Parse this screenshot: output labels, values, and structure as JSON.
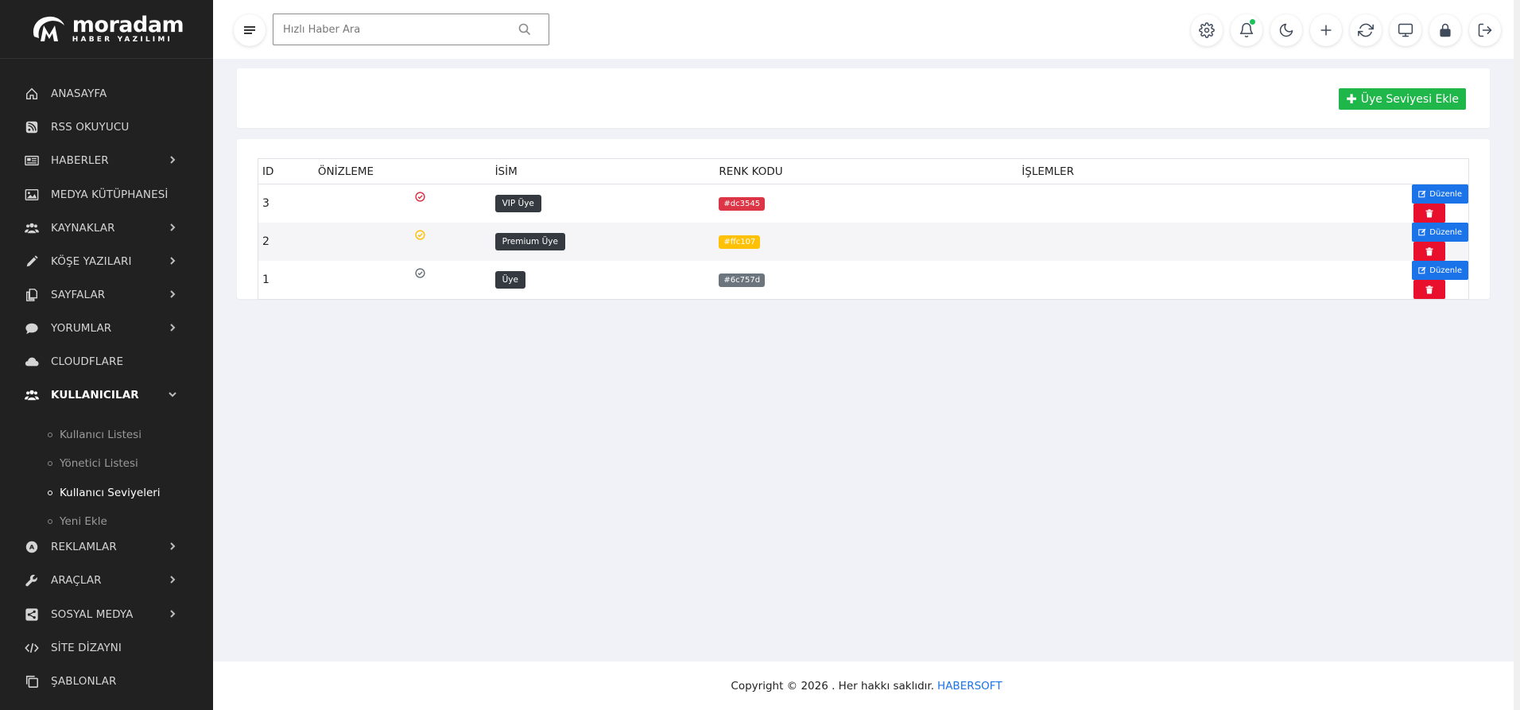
{
  "brand": {
    "name": "moradam",
    "tagline": "HABER YAZILIMI"
  },
  "sidebar": {
    "items": [
      {
        "label": "ANASAYFA",
        "icon": "home-icon",
        "chevron": false
      },
      {
        "label": "RSS OKUYUCU",
        "icon": "rss-icon",
        "chevron": false
      },
      {
        "label": "HABERLER",
        "icon": "newspaper-icon",
        "chevron": true
      },
      {
        "label": "MEDYA KÜTÜPHANESİ",
        "icon": "image-icon",
        "chevron": false
      },
      {
        "label": "KAYNAKLAR",
        "icon": "users-icon",
        "chevron": true
      },
      {
        "label": "KÖŞE YAZILARI",
        "icon": "pencil-icon",
        "chevron": true
      },
      {
        "label": "SAYFALAR",
        "icon": "pages-icon",
        "chevron": true
      },
      {
        "label": "YORUMLAR",
        "icon": "comment-icon",
        "chevron": true
      },
      {
        "label": "CLOUDFLARE",
        "icon": "cloud-icon",
        "chevron": false
      },
      {
        "label": "KULLANICILAR",
        "icon": "users-icon",
        "chevron": true,
        "active": true
      },
      {
        "label": "REKLAMLAR",
        "icon": "ad-icon",
        "chevron": true
      },
      {
        "label": "ARAÇLAR",
        "icon": "wrench-icon",
        "chevron": true
      },
      {
        "label": "SOSYAL MEDYA",
        "icon": "share-icon",
        "chevron": true
      },
      {
        "label": "SİTE DİZAYNI",
        "icon": "code-icon",
        "chevron": false
      },
      {
        "label": "ŞABLONLAR",
        "icon": "copy-icon",
        "chevron": false
      }
    ],
    "subitems": [
      {
        "label": "Kullanıcı Listesi"
      },
      {
        "label": "Yönetici Listesi"
      },
      {
        "label": "Kullanıcı Seviyeleri",
        "active": true
      },
      {
        "label": "Yeni Ekle"
      }
    ]
  },
  "topbar": {
    "search_placeholder": "Hızlı Haber Ara",
    "icons": [
      "gear-icon",
      "bell-icon",
      "moon-icon",
      "plus-icon",
      "refresh-icon",
      "monitor-icon",
      "lock-icon",
      "logout-icon"
    ]
  },
  "actions": {
    "add_label": "Üye Seviyesi Ekle"
  },
  "table": {
    "headers": {
      "id": "ID",
      "preview": "ÖNİZLEME",
      "name": "İSİM",
      "color": "RENK KODU",
      "ops": "İŞLEMLER"
    },
    "edit_label": "Düzenle",
    "rows": [
      {
        "id": "3",
        "name": "VIP Üye",
        "color_code": "#dc3545",
        "color_hex": "#dc3545"
      },
      {
        "id": "2",
        "name": "Premium Üye",
        "color_code": "#ffc107",
        "color_hex": "#ffc107"
      },
      {
        "id": "1",
        "name": "Üye",
        "color_code": "#6c757d",
        "color_hex": "#6c757d"
      }
    ]
  },
  "footer": {
    "text": "Copyright © 2026 . Her hakkı saklıdır.",
    "brand": "HABERSOFT"
  }
}
